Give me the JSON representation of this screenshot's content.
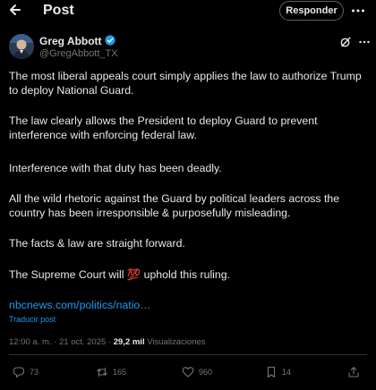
{
  "header": {
    "title": "Post",
    "reply_button": "Responder"
  },
  "author": {
    "name": "Greg Abbott",
    "handle": "@GregAbbott_TX"
  },
  "post": {
    "paragraphs": [
      "The  most liberal appeals court simply applies the law to authorize Trump to deploy National Guard.",
      "The law clearly allows the President to deploy Guard to prevent interference with enforcing federal law.",
      "Interference with that duty has been deadly.",
      "All the wild rhetoric against the Guard by political leaders across the country has been irresponsible & purposefully misleading.",
      "The facts & law are straight forward.",
      "The Supreme Court will 💯 uphold this ruling."
    ],
    "link": "nbcnews.com/politics/natio…",
    "translate": "Traducir post"
  },
  "meta": {
    "time": "12:00 a. m.",
    "separator": "·",
    "date": "21 oct. 2025",
    "views_count": "29,2 mil",
    "views_label": "Visualizaciones"
  },
  "actions": {
    "replies": "73",
    "reposts": "165",
    "likes": "960",
    "bookmarks": "14"
  },
  "colors": {
    "background": "#000000",
    "text": "#e7e9ea",
    "secondary": "#71767b",
    "link": "#1d9bf0",
    "verified": "#1d9bf0"
  },
  "icons": [
    "back-arrow-icon",
    "more-icon",
    "verified-icon",
    "grok-icon",
    "reply-icon",
    "repost-icon",
    "like-icon",
    "bookmark-icon",
    "share-icon"
  ]
}
